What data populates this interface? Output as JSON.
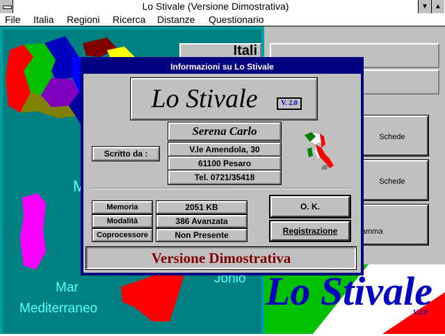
{
  "window": {
    "title": "Lo Stivale (Versione Dimostrativa)",
    "minimize_glyph": "▼",
    "maximize_glyph": "▲"
  },
  "menu": [
    {
      "label": "File"
    },
    {
      "label": "Italia"
    },
    {
      "label": "Regioni"
    },
    {
      "label": "Ricerca"
    },
    {
      "label": "Distanze"
    },
    {
      "label": "Questionario"
    }
  ],
  "map": {
    "labels": {
      "mar_mediterraneo_1": "Mar",
      "mar_mediterraneo_2": "Mediterraneo",
      "ionio_partial": "Jonio",
      "tirreno_partial_m": "M",
      "header_partial": "Itali"
    }
  },
  "right_panel": {
    "buttons": [
      {
        "label": "Schede"
      },
      {
        "label": "Schede"
      },
      {
        "label": "amma"
      }
    ]
  },
  "dialog": {
    "title": "Informazioni su Lo Stivale",
    "app_name": "Lo Stivale",
    "version": "V. 2.0",
    "author_label": "Scritto da :",
    "author": {
      "name": "Serena Carlo",
      "address": "V.le Amendola, 30",
      "city": "61100  Pesaro",
      "phone": "Tel. 0721/35418"
    },
    "sysinfo": [
      {
        "label": "Memoria",
        "value": "2051 KB"
      },
      {
        "label": "Modalità",
        "value": "386 Avanzata"
      },
      {
        "label": "Coprocessore",
        "value": "Non Presente"
      }
    ],
    "ok_button": "O. K.",
    "register_button": "Registrazione",
    "edition": "Versione Dimostrativa"
  },
  "logo": {
    "text": "Lo Stivale",
    "version": "V.2.0"
  },
  "colors": {
    "dialog_border": "#000080",
    "face": "#c0c0c0",
    "sea": "#008080",
    "sea_labels": "#55ffff",
    "edition_text": "#800000",
    "logo_blue": "#0000c0"
  }
}
